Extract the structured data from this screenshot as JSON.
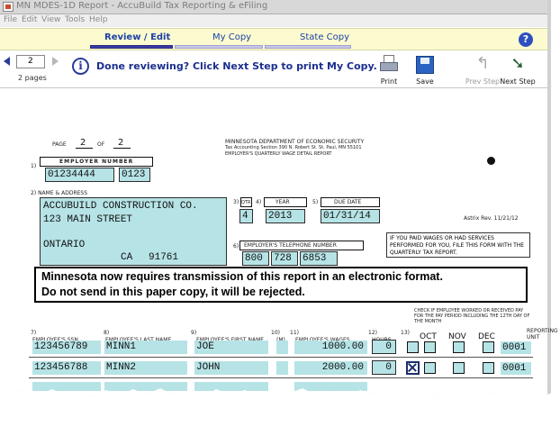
{
  "window": {
    "title": "MN MDES-1D Report - AccuBuild Tax Reporting & eFiling"
  },
  "menu": [
    "File",
    "Edit",
    "View",
    "Tools",
    "Help"
  ],
  "tabs": [
    {
      "label": "Review / Edit",
      "active": true
    },
    {
      "label": "My Copy",
      "active": false
    },
    {
      "label": "State Copy",
      "active": false
    }
  ],
  "toolbar": {
    "page_value": "2",
    "pages_label": "2 pages",
    "info_message": "Done reviewing? Click Next Step to print My Copy.",
    "print_label": "Print",
    "save_label": "Save",
    "prev_step_label": "Prev Step",
    "next_step_label": "Next Step"
  },
  "form": {
    "page_label": "PAGE",
    "of_label": "OF",
    "page_num": "2",
    "page_total": "2",
    "agency_line1": "MINNESOTA DEPARTMENT OF ECONOMIC SECURITY",
    "agency_line2": "Tax Accounting Section   390 N. Robert St.   St. Paul, MN 55101",
    "agency_line3": "EMPLOYER'S QUARTERLY WAGE DETAIL REPORT",
    "field1_num": "1)",
    "employer_number_label": "EMPLOYER NUMBER",
    "employer_number": "01234444",
    "employer_number_suffix": "0123",
    "name_address_label": "2) NAME & ADDRESS",
    "company_name": "ACCUBUILD CONSTRUCTION CO.",
    "street": "123 MAIN STREET",
    "city": "ONTARIO",
    "state": "CA",
    "zip": "91761",
    "qtr_num": "3)",
    "qtr_label": "QTR",
    "quarter": "4",
    "year_num": "4)",
    "year_label": "YEAR",
    "year": "2013",
    "due_num": "5)",
    "due_label": "DUE DATE",
    "due_date": "01/31/14",
    "phone_num": "6)",
    "phone_label": "EMPLOYER'S TELEPHONE NUMBER",
    "phone_area": "800",
    "phone_prefix": "728",
    "phone_line": "6853",
    "astrix_rev": "Astrix  Rev.  11/21/12",
    "side_notice": "IF YOU PAID WAGES OR HAD SERVICES PERFORMED FOR YOU, FILE THIS FORM WITH THE QUARTERLY TAX REPORT.",
    "notice_line1": "Minnesota now requires transmission of this report in an electronic format.",
    "notice_line2": "Do not send in this paper copy, it will be rejected.",
    "col_ssn": "EMPLOYEE'S SSN",
    "col_last": "EMPLOYEE'S LAST NAME",
    "col_first": "EMPLOYEE'S FIRST NAME",
    "col_mi": "(M)",
    "col_wages": "EMPLOYEE'S WAGES",
    "col_hours": "HOURS",
    "col_check_title": "CHECK IF EMPLOYEE WORKED OR RECEIVED PAY FOR THE PAY PERIOD INCLUDING THE 12TH DAY OF THE MONTH",
    "col_unit": "REPORTING UNIT",
    "num7": "7)",
    "num8": "8)",
    "num9": "9)",
    "num10": "10)",
    "num11": "11)",
    "num12": "12)",
    "num13": "13)",
    "month_oct": "OCT",
    "month_nov": "NOV",
    "month_dec": "DEC",
    "rows": [
      {
        "ssn": "123456789",
        "last": "MINN1",
        "first": "JOE",
        "wages": "1000.00",
        "hours": "0",
        "oct": false,
        "nov": false,
        "dec": false,
        "unit": "0001"
      },
      {
        "ssn": "123456788",
        "last": "MINN2",
        "first": "JOHN",
        "wages": "2000.00",
        "hours": "0",
        "oct": true,
        "nov": false,
        "dec": false,
        "unit": "0001"
      }
    ]
  },
  "colors": {
    "field_fill": "#b6e3e6",
    "tab_strip": "#fbfbcf",
    "accent_blue": "#1c2f8f"
  }
}
